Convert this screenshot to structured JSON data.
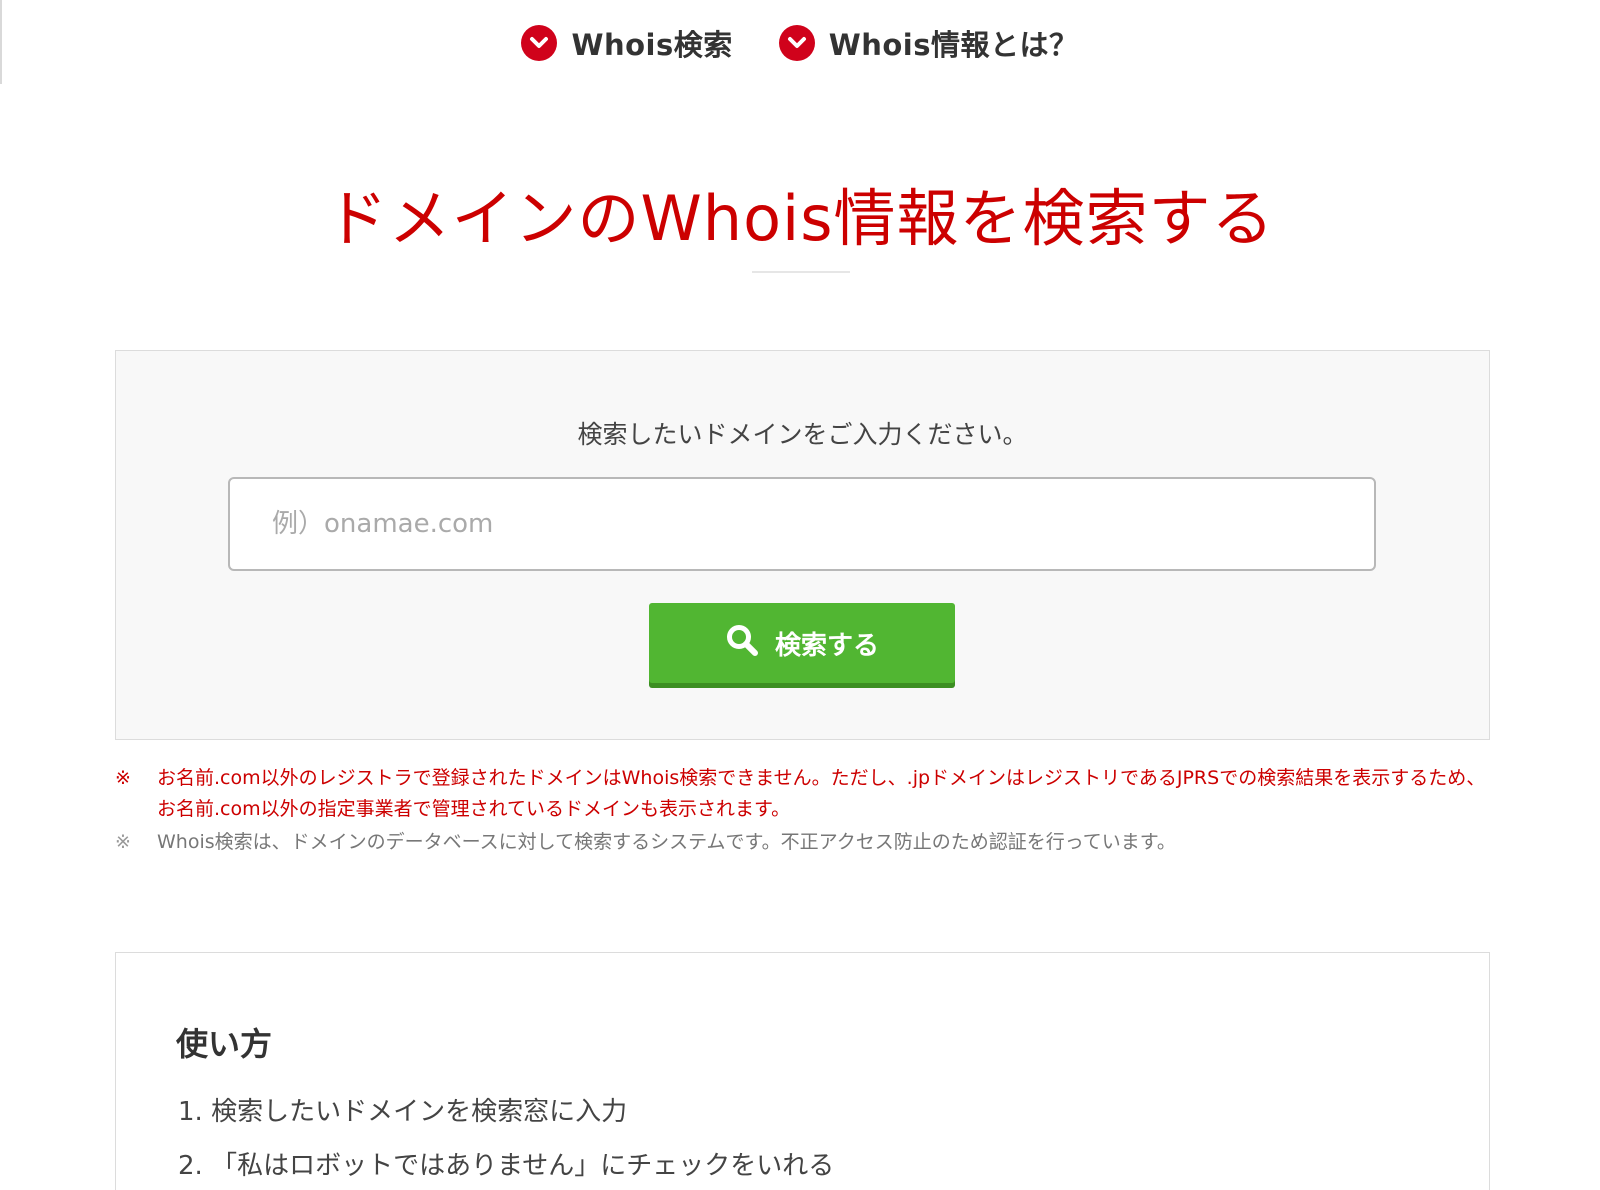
{
  "topnav": {
    "items": [
      {
        "label": "Whois検索",
        "icon": "chevron-down-circle-icon"
      },
      {
        "label": "Whois情報とは？",
        "icon": "chevron-down-circle-icon"
      }
    ]
  },
  "title": "ドメインのWhois情報を検索する",
  "search": {
    "prompt": "検索したいドメインをご入力ください。",
    "placeholder": "例）onamae.com",
    "value": "",
    "button_label": "検索する",
    "button_icon": "search-icon"
  },
  "notes": [
    {
      "mark": "※",
      "text": "お名前.com以外のレジストラで登録されたドメインはWhois検索できません。ただし、.jpドメインはレジストリであるJPRSでの検索結果を表示するため、お名前.com以外の指定事業者で管理されているドメインも表示されます。"
    },
    {
      "mark": "※",
      "text": "Whois検索は、ドメインのデータベースに対して検索するシステムです。不正アクセス防止のため認証を行っています。"
    }
  ],
  "howto": {
    "heading": "使い方",
    "steps": [
      "1. 検索したいドメインを検索窓に入力",
      "2. 「私はロボットではありません」にチェックをいれる"
    ]
  },
  "colors": {
    "accent_red": "#cc0000",
    "button_green": "#51b632"
  }
}
